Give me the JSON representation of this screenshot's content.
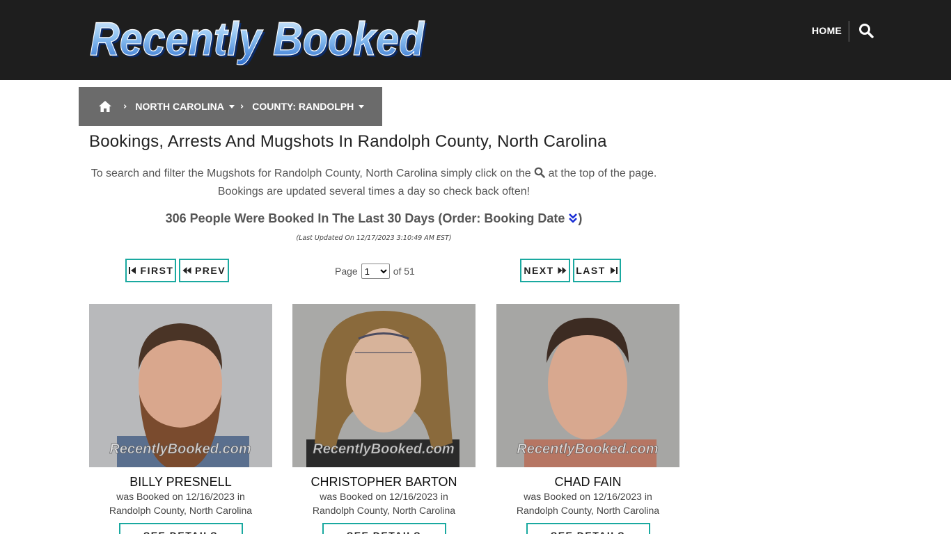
{
  "site": {
    "logo_text": "Recently Booked",
    "nav": {
      "home": "HOME"
    },
    "icons": {
      "search": "search-icon",
      "home": "home-icon"
    },
    "colors": {
      "header_bg": "#1e1e1e",
      "accent": "#1aa9a0",
      "breadcrumb_bg": "#6b6b6b",
      "order_icon": "#1a2fd6"
    }
  },
  "breadcrumb": {
    "items": [
      {
        "label": "NORTH CAROLINA"
      },
      {
        "label": "COUNTY: RANDOLPH"
      }
    ]
  },
  "page": {
    "title": "Bookings, Arrests And Mugshots In Randolph County, North Carolina",
    "intro_before": "To search and filter the Mugshots for Randolph County, North Carolina simply click on the",
    "intro_after": "at the top of the page. Bookings are updated several times a day so check back often!",
    "count_text": "306 People Were Booked In The Last 30 Days (Order: Booking Date",
    "count_close": ")",
    "updated": "(Last Updated On 12/17/2023 3:10:49 AM EST)"
  },
  "pagination": {
    "first": "FIRST",
    "prev": "PREV",
    "next": "NEXT",
    "last": "LAST",
    "page_label": "Page",
    "current_page": "1",
    "of_label": "of 51"
  },
  "watermark": "RecentlyBooked.com",
  "people": [
    {
      "name": "BILLY PRESNELL",
      "booked_line": "was Booked on 12/16/2023 in",
      "location": "Randolph County, North Carolina",
      "details": "SEE DETAILS"
    },
    {
      "name": "CHRISTOPHER BARTON",
      "booked_line": "was Booked on 12/16/2023 in",
      "location": "Randolph County, North Carolina",
      "details": "SEE DETAILS"
    },
    {
      "name": "CHAD FAIN",
      "booked_line": "was Booked on 12/16/2023 in",
      "location": "Randolph County, North Carolina",
      "details": "SEE DETAILS"
    }
  ]
}
